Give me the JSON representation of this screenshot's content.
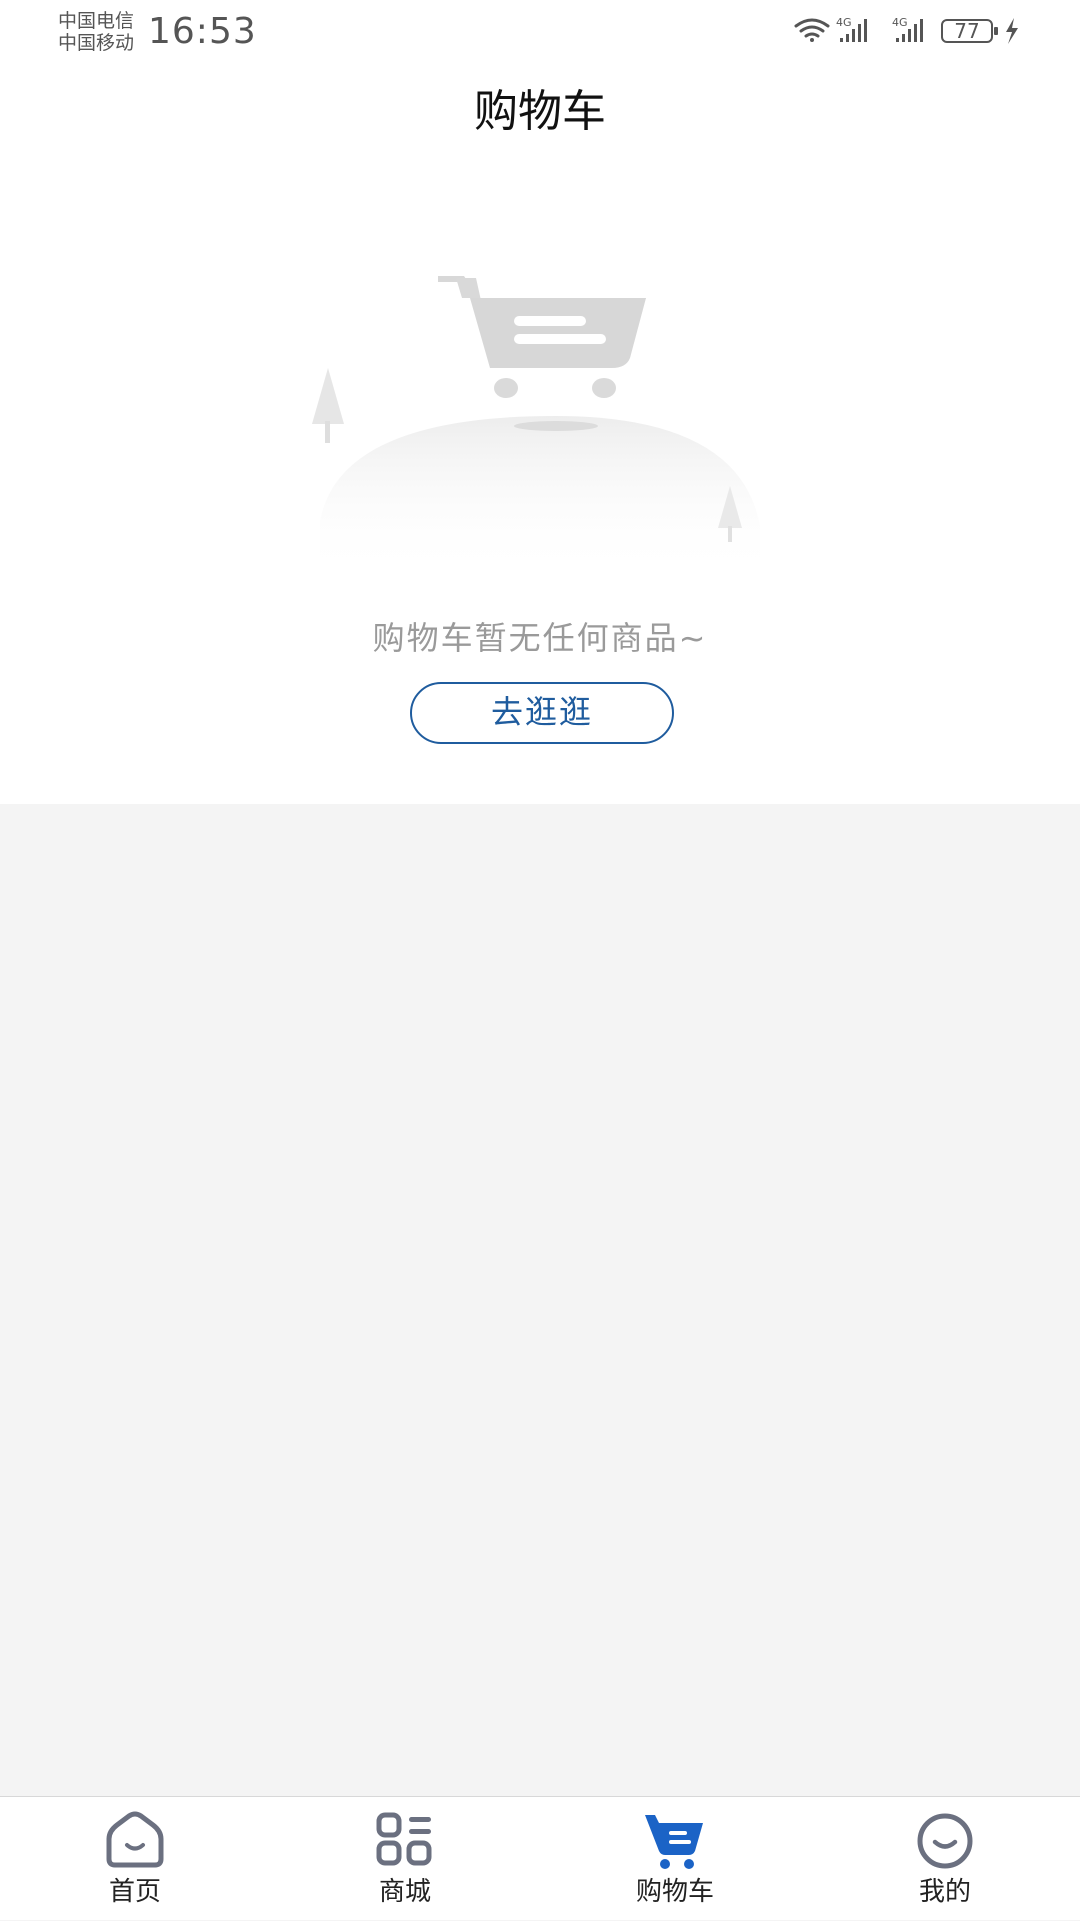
{
  "status_bar": {
    "carrier_1": "中国电信",
    "carrier_2": "中国移动",
    "time": "16:53",
    "network_1": "4G",
    "network_2": "4G",
    "battery": "77"
  },
  "header": {
    "title": "购物车"
  },
  "empty_state": {
    "message": "购物车暂无任何商品~",
    "button_label": "去逛逛",
    "illustration": "empty-cart-illustration"
  },
  "tab_bar": {
    "active": "cart",
    "active_color": "#1b63c6",
    "inactive_color": "#6b7080",
    "tabs": [
      {
        "key": "home",
        "label": "首页",
        "icon": "home-icon"
      },
      {
        "key": "mall",
        "label": "商城",
        "icon": "grid-icon"
      },
      {
        "key": "cart",
        "label": "购物车",
        "icon": "cart-icon"
      },
      {
        "key": "mine",
        "label": "我的",
        "icon": "smile-face-icon"
      }
    ]
  },
  "colors": {
    "accent": "#1f5c9e",
    "page_background": "#f4f4f4",
    "content_background": "#ffffff"
  }
}
